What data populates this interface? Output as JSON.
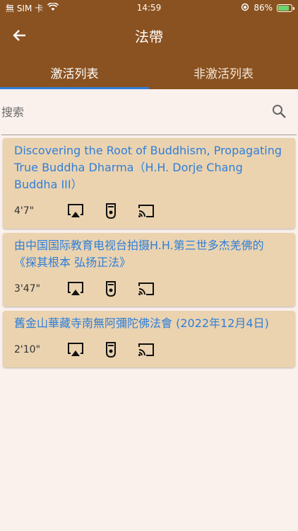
{
  "status_bar": {
    "carrier": "無 SIM 卡",
    "time": "14:59",
    "battery": "86%"
  },
  "header": {
    "title": "法帶"
  },
  "tabs": [
    {
      "label": "激活列表",
      "active": true
    },
    {
      "label": "非激活列表",
      "active": false
    }
  ],
  "search": {
    "placeholder": "搜索"
  },
  "items": [
    {
      "title": "Discovering the Root of Buddhism, Propagating True Buddha Dharma（H.H. Dorje Chang Buddha III）",
      "duration": "4'7\""
    },
    {
      "title": "由中国国际教育电视台拍摄H.H.第三世多杰羌佛的《探其根本 弘扬正法》",
      "duration": "3'47\""
    },
    {
      "title": "舊金山華藏寺南無阿彌陀佛法會 (2022年12月4日)",
      "duration": "2'10\""
    }
  ],
  "colors": {
    "header_bg": "#8a5220",
    "accent": "#2f7fd8",
    "card_bg": "#ebd3b0",
    "page_bg": "#fbf1ec"
  }
}
